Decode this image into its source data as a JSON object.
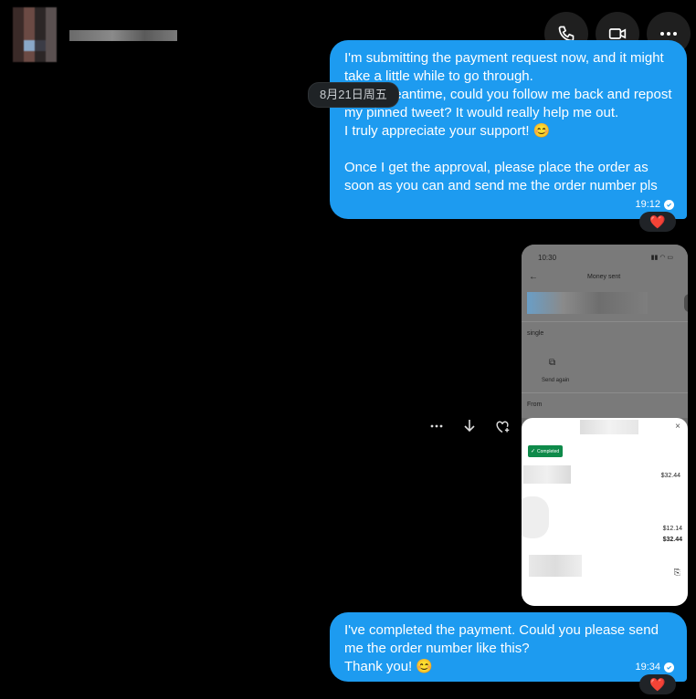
{
  "header": {
    "avatar_icon": "user-avatar-pixelated",
    "name_blurred": ""
  },
  "top_actions": [
    {
      "icon": "phone-icon"
    },
    {
      "icon": "video-icon"
    },
    {
      "icon": "more-icon"
    }
  ],
  "date_separator": "8月21日周五",
  "messages": [
    {
      "text": "I'm submitting the payment request now, and it might take a little while to go through.\nIn the meantime, could you follow me back and repost my pinned tweet? It would really help me out.\nI truly appreciate your support! 😊\n\nOnce I get the approval, please place the order as soon as you can and send me the order number pls",
      "time": "19:12",
      "reaction": "❤️"
    },
    {
      "time": "",
      "attachment": {
        "status_time": "10:30",
        "screen_title": "Money sent",
        "label_single": "single",
        "send_again": "Send again",
        "from_label": "From",
        "badge": "Completed",
        "amount1": "$32.44",
        "amount2": "$12.14",
        "amount3": "$32.44"
      }
    },
    {
      "text": "I've completed the payment. Could you please send me the order number like this?\nThank you! 😊",
      "time": "19:34",
      "reaction": "❤️"
    }
  ],
  "media_toolbar": [
    {
      "icon": "more-icon"
    },
    {
      "icon": "download-icon"
    },
    {
      "icon": "react-heart-icon"
    }
  ],
  "colors": {
    "bubble": "#1d9bf0",
    "background": "#000000",
    "reaction_heart": "#f91880"
  }
}
